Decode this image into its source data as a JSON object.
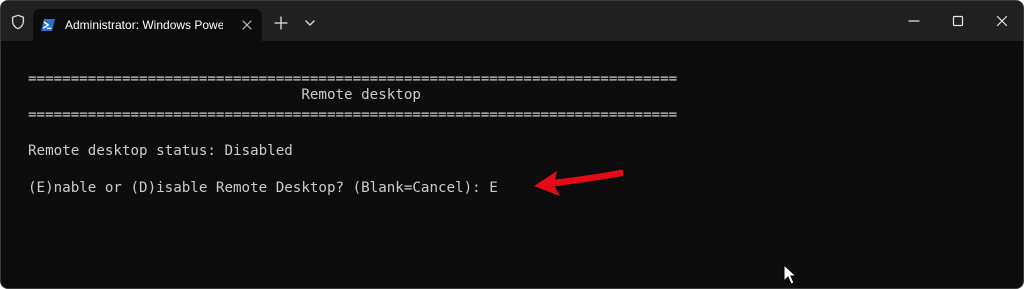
{
  "window": {
    "tab_title": "Administrator: Windows PowerShell",
    "tab_icon": "powershell-icon",
    "title_icon": "shield-icon"
  },
  "terminal": {
    "separator_top": "============================================================================",
    "heading": "                                Remote desktop",
    "separator_bottom": "============================================================================",
    "status_line": "Remote desktop status: Disabled",
    "prompt_line": "(E)nable or (D)isable Remote Desktop? (Blank=Cancel): E"
  },
  "annotation": {
    "arrow_color": "#e30b17"
  },
  "colors": {
    "terminal_bg": "#0c0c0c",
    "titlebar_bg": "#202020",
    "text": "#cccccc"
  }
}
